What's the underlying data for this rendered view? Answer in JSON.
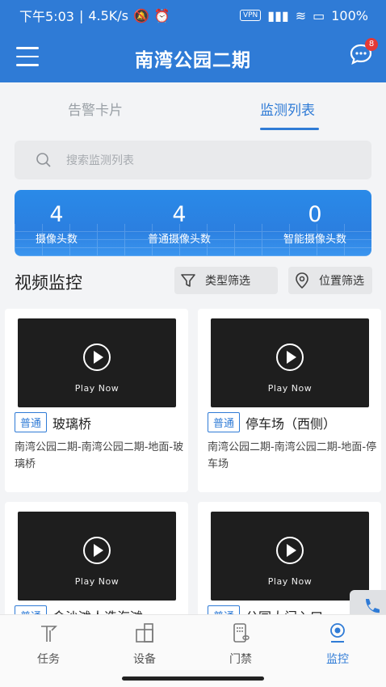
{
  "status": {
    "time": "下午5:03",
    "speed": "4.5K/s",
    "vpn": "VPN",
    "battery": "100"
  },
  "header": {
    "title": "南湾公园二期",
    "message_badge": "8"
  },
  "tabs": [
    "告警卡片",
    "监测列表"
  ],
  "search": {
    "placeholder": "搜索监测列表"
  },
  "stats": [
    {
      "value": "4",
      "label": "摄像头数"
    },
    {
      "value": "4",
      "label": "普通摄像头数"
    },
    {
      "value": "0",
      "label": "智能摄像头数"
    }
  ],
  "section": {
    "title": "视频监控",
    "filter_type": "类型筛选",
    "filter_location": "位置筛选"
  },
  "play_now": "Play Now",
  "cameras": [
    {
      "tag": "普通",
      "name": "玻璃桥",
      "address": "南湾公园二期-南湾公园二期-地面-玻璃桥"
    },
    {
      "tag": "普通",
      "name": "停车场（西侧）",
      "address": "南湾公园二期-南湾公园二期-地面-停车场"
    },
    {
      "tag": "普通",
      "name": "金沙滩人造海滩",
      "address": ""
    },
    {
      "tag": "普通",
      "name": "公园大门入口",
      "address": ""
    }
  ],
  "nav": [
    "任务",
    "设备",
    "门禁",
    "监控"
  ],
  "colors": {
    "primary": "#2f7bd6",
    "badge": "#e53935"
  }
}
